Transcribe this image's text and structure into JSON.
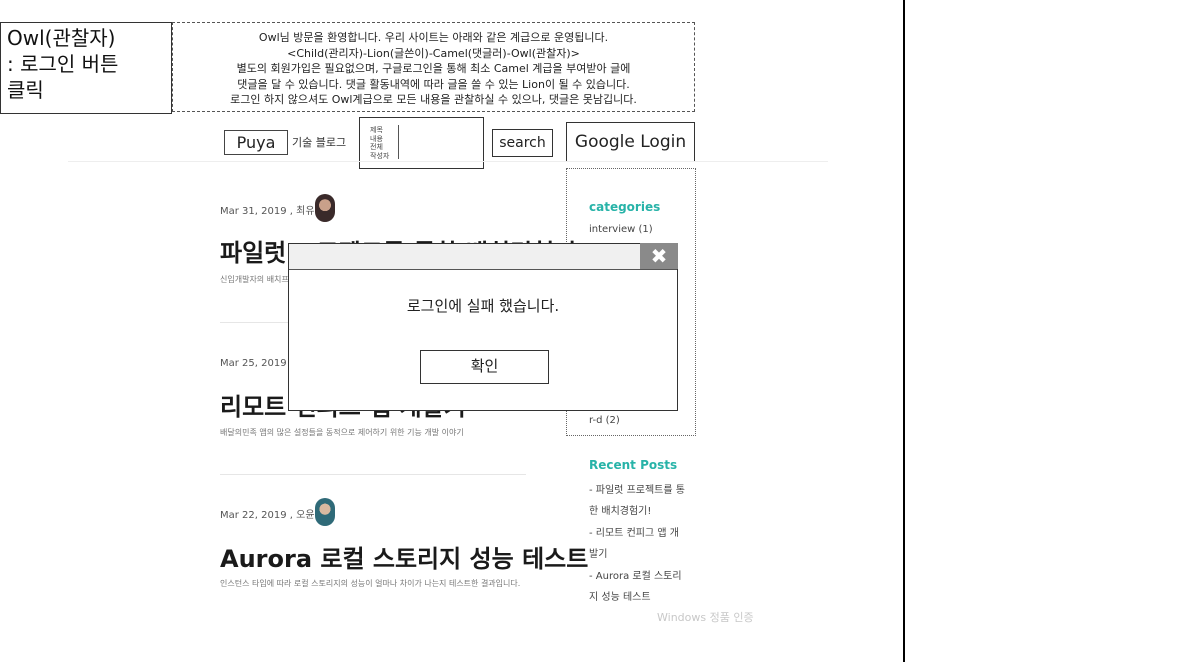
{
  "role_box": {
    "line1": "Owl(관찰자)",
    "line2": ": 로그인 버튼",
    "line3": "클릭"
  },
  "notice": {
    "lines": [
      "Owl님 방문을 환영합니다. 우리 사이트는 아래와 같은 계급으로 운영됩니다.",
      "<Child(관리자)-Lion(글쓴이)-Camel(댓글러)-Owl(관찰자)>",
      "별도의 회원가입은 필요없으며, 구글로그인을 통해 최소 Camel 계급을 부여받아 글에",
      "댓글을 달 수 있습니다. 댓글 활동내역에 따라 글을 쓸 수 있는 Lion이 될 수 있습니다.",
      "로그인 하지 않으셔도 Owl계급으로 모든 내용을 관찰하실 수 있으나, 댓글은 못남깁니다."
    ]
  },
  "header": {
    "blog_name": "Puya",
    "blog_subtitle": "기술 블로그",
    "search_options": [
      "제목",
      "내용",
      "전체",
      "작성자"
    ],
    "search_label": "search",
    "google_login_label": "Google Login"
  },
  "posts": [
    {
      "meta": "Mar 31, 2019 , 최유성",
      "title": "파일럿 프로젝트를 통한 배치경험기!",
      "desc": "신입개발자의 배치프로젝트 경험기"
    },
    {
      "meta": "Mar 25, 2019 , 이",
      "title": "리모트 컨피그 앱 개발기",
      "desc": "배달의민족 앱의 많은 설정들을 동적으로 제어하기 위한 기능 개발 이야기"
    },
    {
      "meta": "Mar 22, 2019 , 오윤택",
      "title": "Aurora 로컬 스토리지 성능 테스트",
      "desc": "인스턴스 타입에 따라 로컬 스토리지의 성능이 얼마나 차이가 나는지 테스트한 결과입니다."
    }
  ],
  "sidebar": {
    "categories_title": "categories",
    "categories": [
      "interview (1)",
      "r-d (2)"
    ],
    "recent_title": "Recent Posts",
    "recent_lines": [
      "- 파일럿 프로젝트를 통",
      "한 배치경험기!",
      "- 리모트 컨피그 앱 개",
      "발기",
      "- Aurora 로컬 스토리",
      "지 성능 테스트"
    ]
  },
  "watermark": "Windows 정품 인증",
  "modal": {
    "message": "로그인에 실패 했습니다.",
    "ok_label": "확인",
    "close_glyph": "✖"
  },
  "colors": {
    "accent": "#27b3a8",
    "modal_close_bg": "#8a8a8a"
  }
}
